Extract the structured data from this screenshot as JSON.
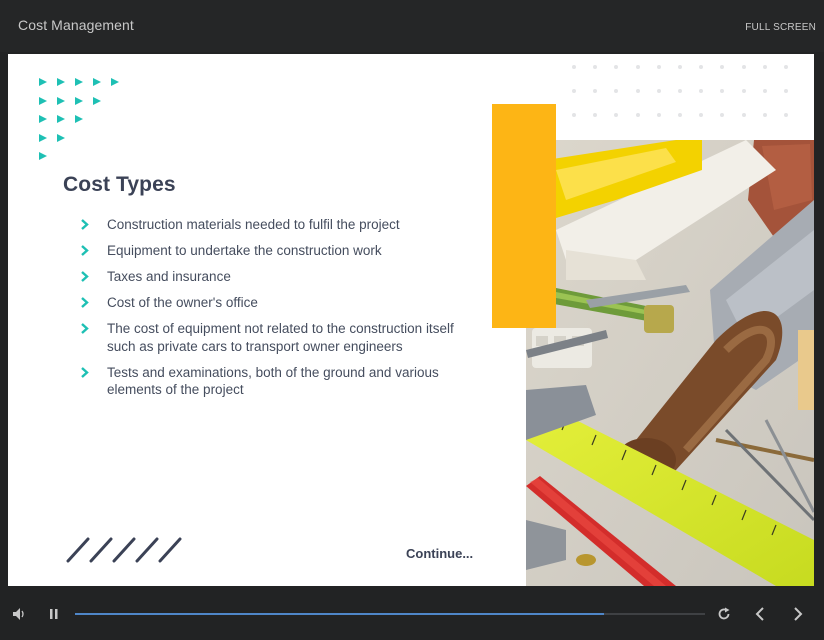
{
  "app": {
    "title": "Cost Management",
    "fullscreen_label": "FULL SCREEN"
  },
  "slide": {
    "title": "Cost Types",
    "bullets": [
      "Construction materials needed to fulfil the project",
      "Equipment to undertake the construction work",
      "Taxes and insurance",
      "Cost of the owner's office",
      "The cost of equipment not related to the construction itself such as private cars to transport owner engineers",
      "Tests and examinations, both of the ground and various elements of the project"
    ],
    "continue_label": "Continue...",
    "image": "construction-tools-photo"
  },
  "player": {
    "progress": 0.84,
    "icons": [
      "volume-icon",
      "pause-icon",
      "replay-icon",
      "prev-icon",
      "next-icon"
    ]
  },
  "colors": {
    "accent_teal": "#1ec0b4",
    "accent_yellow": "#fdb515",
    "title_navy": "#3b4256",
    "progress_blue": "#4f86c8",
    "chrome_dark": "#252627"
  }
}
